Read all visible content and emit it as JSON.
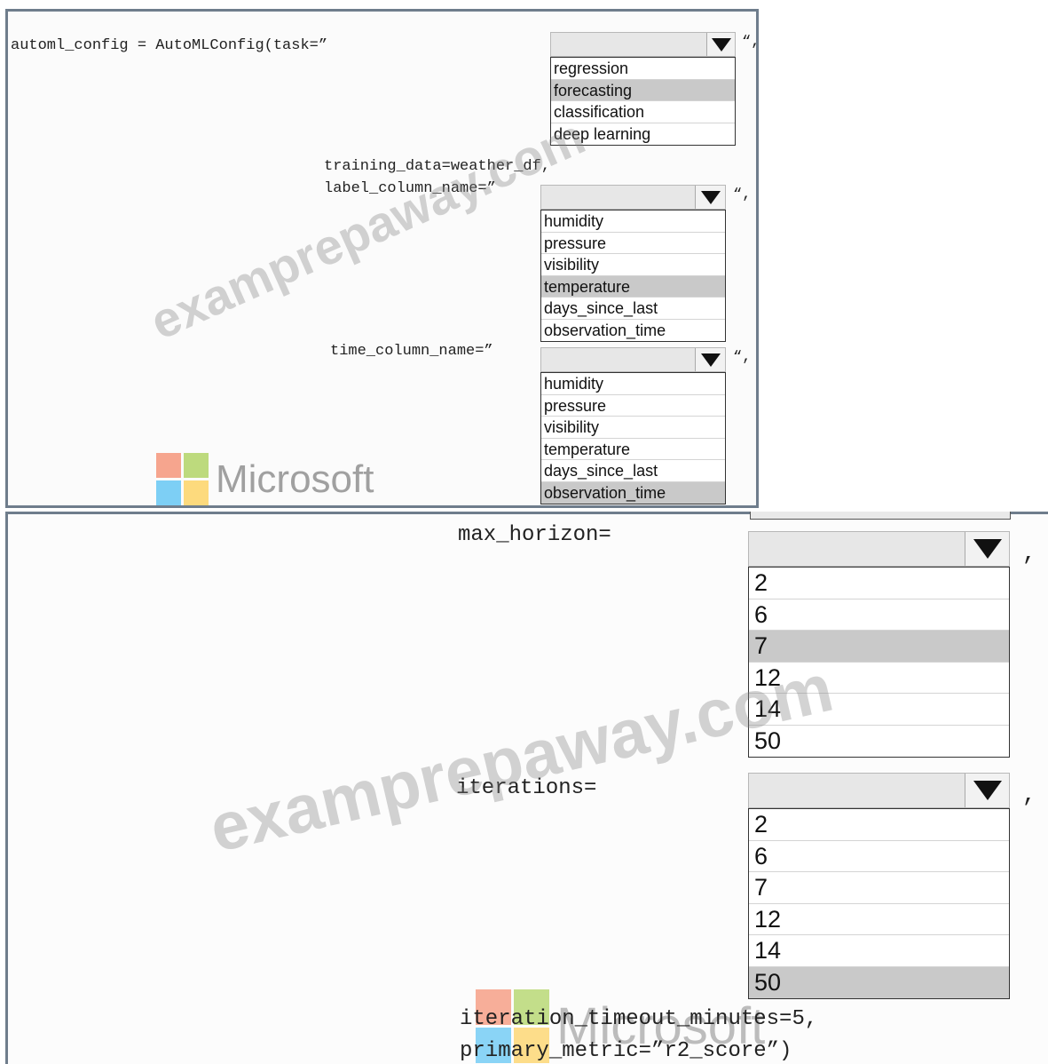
{
  "code": {
    "line1": "automl_config = AutoMLConfig(task=”",
    "line2": "training_data=weather_df,",
    "line3": "label_column_name=”",
    "line4": "time_column_name=”",
    "line5": "max_horizon=",
    "line6": "iterations=",
    "line7": "iteration_timeout_minutes=5,",
    "line8": "primary_metric=”r2_score”)",
    "quote_comma": "“,",
    "comma": ","
  },
  "dropdowns": {
    "task": {
      "options": [
        "regression",
        "forecasting",
        "classification",
        "deep learning"
      ],
      "selected_index": 1
    },
    "label_column": {
      "options": [
        "humidity",
        "pressure",
        "visibility",
        "temperature",
        "days_since_last",
        "observation_time"
      ],
      "selected_index": 3
    },
    "time_column": {
      "options": [
        "humidity",
        "pressure",
        "visibility",
        "temperature",
        "days_since_last",
        "observation_time"
      ],
      "selected_index": 5
    },
    "max_horizon": {
      "options": [
        "2",
        "6",
        "7",
        "12",
        "14",
        "50"
      ],
      "selected_index": 2
    },
    "iterations": {
      "options": [
        "2",
        "6",
        "7",
        "12",
        "14",
        "50"
      ],
      "selected_index": 5
    }
  },
  "watermarks": {
    "site_text": "examprepaway.com",
    "logo_text": "Microsoft"
  },
  "colors": {
    "frame": "#6f7d8c",
    "selected_option": "#c9c9c9",
    "ms_red": "#f25022",
    "ms_green": "#7fba00",
    "ms_blue": "#00a4ef",
    "ms_yellow": "#ffb900"
  }
}
